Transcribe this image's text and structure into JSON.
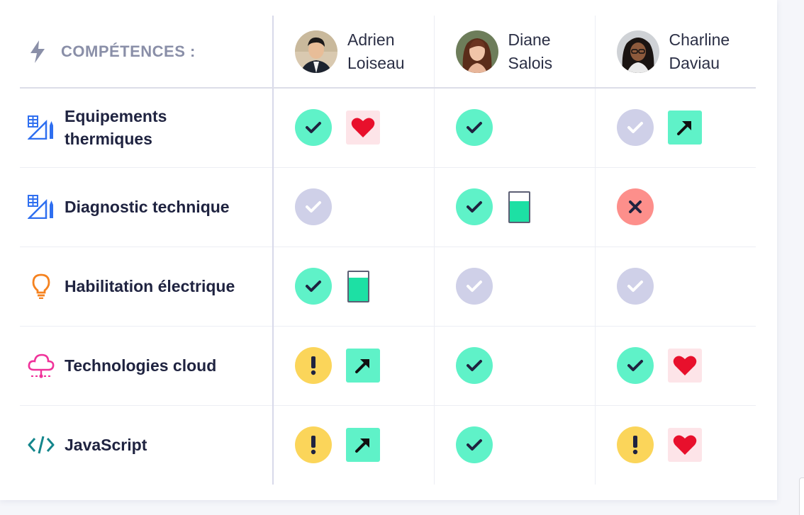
{
  "header": {
    "competences_label": "COMPÉTENCES :"
  },
  "people": [
    {
      "first": "Adrien",
      "last": "Loiseau"
    },
    {
      "first": "Diane",
      "last": "Salois"
    },
    {
      "first": "Charline",
      "last": "Daviau"
    }
  ],
  "skills": [
    {
      "line1": "Equipements",
      "line2": "thermiques",
      "icon": "ruler-pencil-icon",
      "icon_color": "#2f6ff0"
    },
    {
      "line1": "Diagnostic technique",
      "icon": "ruler-pencil-icon",
      "icon_color": "#2f6ff0"
    },
    {
      "line1": "Habilitation électrique",
      "icon": "lightbulb-icon",
      "icon_color": "#f5821f"
    },
    {
      "line1": "Technologies cloud",
      "icon": "cloud-network-icon",
      "icon_color": "#f0329a"
    },
    {
      "line1": "JavaScript",
      "icon": "code-icon",
      "icon_color": "#14868c"
    }
  ],
  "matrix": [
    [
      {
        "status": "validated",
        "extra": "heart"
      },
      {
        "status": "validated"
      },
      {
        "status": "pending",
        "extra": "progress-arrow"
      }
    ],
    [
      {
        "status": "pending"
      },
      {
        "status": "validated",
        "extra": "gauge",
        "gauge_level": 0.7
      },
      {
        "status": "rejected"
      }
    ],
    [
      {
        "status": "validated",
        "extra": "gauge",
        "gauge_level": 0.8
      },
      {
        "status": "pending"
      },
      {
        "status": "pending"
      }
    ],
    [
      {
        "status": "warning",
        "extra": "progress-arrow"
      },
      {
        "status": "validated"
      },
      {
        "status": "validated",
        "extra": "heart"
      }
    ],
    [
      {
        "status": "warning",
        "extra": "progress-arrow"
      },
      {
        "status": "validated"
      },
      {
        "status": "warning",
        "extra": "heart"
      }
    ]
  ],
  "colors": {
    "validated": "#5ff2c8",
    "pending": "#cfd0e8",
    "rejected": "#fd8f8b",
    "warning": "#fbd55a",
    "heart": "#e8102c",
    "heart_bg": "#fde4e8",
    "gauge_fill": "#1de0a4"
  }
}
